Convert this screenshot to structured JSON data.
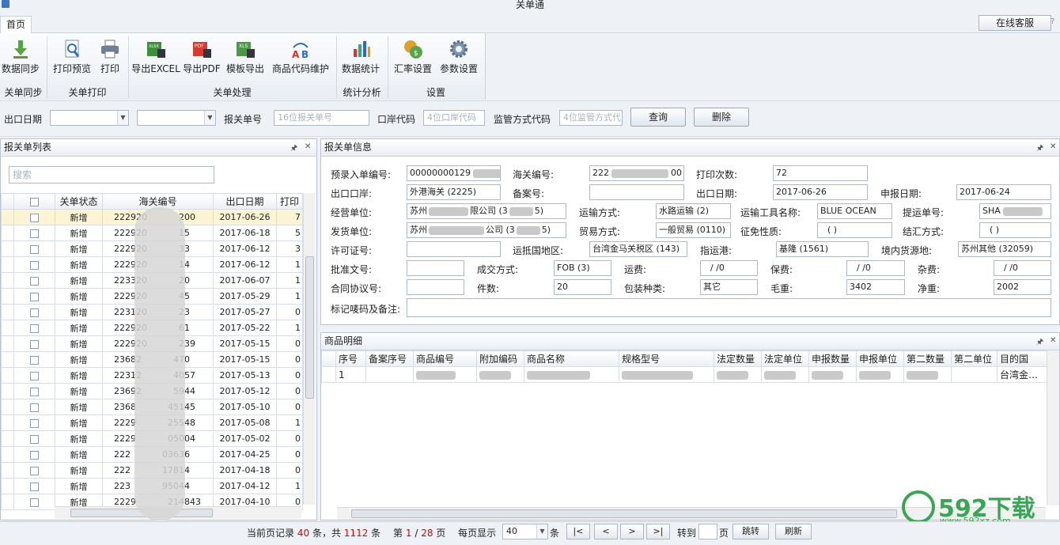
{
  "app": {
    "title": "关单通"
  },
  "tabs": {
    "home": "首页",
    "online_service": "在线客服"
  },
  "ribbon": {
    "groups": [
      {
        "label": "关单同步"
      },
      {
        "label": "关单打印"
      },
      {
        "label": "关单处理"
      },
      {
        "label": "统计分析"
      },
      {
        "label": "设置"
      }
    ],
    "buttons": {
      "sync": "数据同步",
      "print_preview": "打印预览",
      "print": "打印",
      "export_excel": "导出EXCEL",
      "export_pdf": "导出PDF",
      "template_export": "模板导出",
      "goods_code": "商品代码维护",
      "stats": "数据统计",
      "exchange": "汇率设置",
      "params": "参数设置"
    }
  },
  "search": {
    "export_date": "出口日期",
    "customs_no_label": "报关单号",
    "customs_no_ph": "16位报关单号",
    "port_label": "口岸代码",
    "port_ph": "4位口岸代码",
    "supervise_label": "监管方式代码",
    "supervise_ph": "4位监管方式代",
    "query": "查询",
    "delete": "删除"
  },
  "list_panel": {
    "title": "报关单列表",
    "search_ph": "搜索",
    "columns": [
      "关单状态",
      "海关编号",
      "出口日期",
      "打印"
    ],
    "rows": [
      {
        "status": "新增",
        "no_a": "222920",
        "no_b": "200",
        "date": "2017-06-26",
        "print": "7"
      },
      {
        "status": "新增",
        "no_a": "222920",
        "no_b": "15",
        "date": "2017-06-18",
        "print": "5"
      },
      {
        "status": "新增",
        "no_a": "222920",
        "no_b": "33",
        "date": "2017-06-12",
        "print": "3"
      },
      {
        "status": "新增",
        "no_a": "222920",
        "no_b": "14",
        "date": "2017-06-12",
        "print": "1"
      },
      {
        "status": "新增",
        "no_a": "223320",
        "no_b": "20",
        "date": "2017-06-07",
        "print": "1"
      },
      {
        "status": "新增",
        "no_a": "222920",
        "no_b": "45",
        "date": "2017-05-29",
        "print": "1"
      },
      {
        "status": "新增",
        "no_a": "223120",
        "no_b": "23",
        "date": "2017-05-27",
        "print": "0"
      },
      {
        "status": "新增",
        "no_a": "222920",
        "no_b": "61",
        "date": "2017-05-22",
        "print": "1"
      },
      {
        "status": "新增",
        "no_a": "222920",
        "no_b": "239",
        "date": "2017-05-15",
        "print": "0"
      },
      {
        "status": "新增",
        "no_a": "23682",
        "no_b": "470",
        "date": "2017-05-15",
        "print": "0"
      },
      {
        "status": "新增",
        "no_a": "22312",
        "no_b": "4057",
        "date": "2017-05-13",
        "print": "0"
      },
      {
        "status": "新增",
        "no_a": "23692",
        "no_b": "5944",
        "date": "2017-05-12",
        "print": "0"
      },
      {
        "status": "新增",
        "no_a": "2368",
        "no_b": "45145",
        "date": "2017-05-10",
        "print": "0"
      },
      {
        "status": "新增",
        "no_a": "2229",
        "no_b": "25548",
        "date": "2017-05-08",
        "print": "1"
      },
      {
        "status": "新增",
        "no_a": "2229",
        "no_b": "05004",
        "date": "2017-05-02",
        "print": "0"
      },
      {
        "status": "新增",
        "no_a": "222",
        "no_b": "03636",
        "date": "2017-04-25",
        "print": "0"
      },
      {
        "status": "新增",
        "no_a": "222",
        "no_b": "17814",
        "date": "2017-04-18",
        "print": "0"
      },
      {
        "status": "新增",
        "no_a": "223",
        "no_b": "95044",
        "date": "2017-04-12",
        "print": "1"
      },
      {
        "status": "新增",
        "no_a": "2229",
        "no_b": "214843",
        "date": "2017-04-10",
        "print": "0"
      }
    ]
  },
  "info_panel": {
    "title": "报关单信息",
    "labels": {
      "entry_no": "预录入单编号:",
      "customs_no": "海关编号:",
      "print_count": "打印次数:",
      "port": "出口口岸:",
      "record_no": "备案号:",
      "export_date": "出口日期:",
      "declare_date": "申报日期:",
      "business_unit": "经营单位:",
      "transport": "运输方式:",
      "vehicle": "运输工具名称:",
      "bill_no": "提运单号:",
      "shipper": "发货单位:",
      "trade_mode": "贸易方式:",
      "tax_nature": "征免性质:",
      "settle": "结汇方式:",
      "license": "许可证号:",
      "dest_country": "运抵国地区:",
      "port_of_loading": "指运港:",
      "domestic_source": "境内货源地:",
      "approval": "批准文号:",
      "deal_mode": "成交方式:",
      "freight": "运费:",
      "insurance": "保费:",
      "misc": "杂费:",
      "contract": "合同协议号:",
      "pieces": "件数:",
      "package": "包装种类:",
      "gross": "毛重:",
      "net": "净重:",
      "marks": "标记唛码及备注:"
    },
    "values": {
      "entry_no": "00000000129",
      "customs_no_a": "222",
      "customs_no_b": "00",
      "print_count": "72",
      "port": "外港海关 (2225)",
      "export_date": "2017-06-26",
      "declare_date": "2017-06-24",
      "business_unit_a": "苏州",
      "business_unit_b": "限公司 (3",
      "business_unit_c": "5)",
      "transport": "水路运输 (2)",
      "vehicle": "BLUE OCEAN",
      "bill_no": "SHA",
      "shipper_a": "苏州",
      "shipper_b": "公司 (3",
      "shipper_c": "5)",
      "trade_mode": "一般贸易 (0110)",
      "tax_nature": "( )",
      "settle": "( )",
      "dest_country": "台湾金马关税区 (143)",
      "port_of_loading": "基隆 (1561)",
      "domestic_source": "苏州其他 (32059)",
      "deal_mode": "FOB (3)",
      "freight": "/ /0",
      "insurance": "/ /0",
      "misc": "/ /0",
      "pieces": "20",
      "package": "其它",
      "gross": "3402",
      "net": "2002"
    }
  },
  "goods_panel": {
    "title": "商品明细",
    "columns": [
      "序号",
      "备案序号",
      "商品编号",
      "附加编码",
      "商品名称",
      "规格型号",
      "法定数量",
      "法定单位",
      "申报数量",
      "申报单位",
      "第二数量",
      "第二单位",
      "目的国"
    ],
    "row": {
      "seq": "1",
      "dest": "台湾金…"
    }
  },
  "pager": {
    "prefix": "当前页记录",
    "count": "40",
    "mid": "条，共",
    "total": "1112",
    "suffix": "条",
    "page_prefix": "第",
    "page": "1",
    "slash": "/",
    "pages": "28",
    "page_unit": "页",
    "per_page_label": "每页显示",
    "per_page": "40",
    "per_page_unit": "条",
    "first": "|<",
    "prev": "<",
    "next": ">",
    "last": ">|",
    "goto": "转到",
    "goto_unit": "页",
    "jump": "跳转",
    "refresh": "刷新"
  },
  "watermark": {
    "brand": "592下载",
    "url": "www.592xz.com"
  }
}
